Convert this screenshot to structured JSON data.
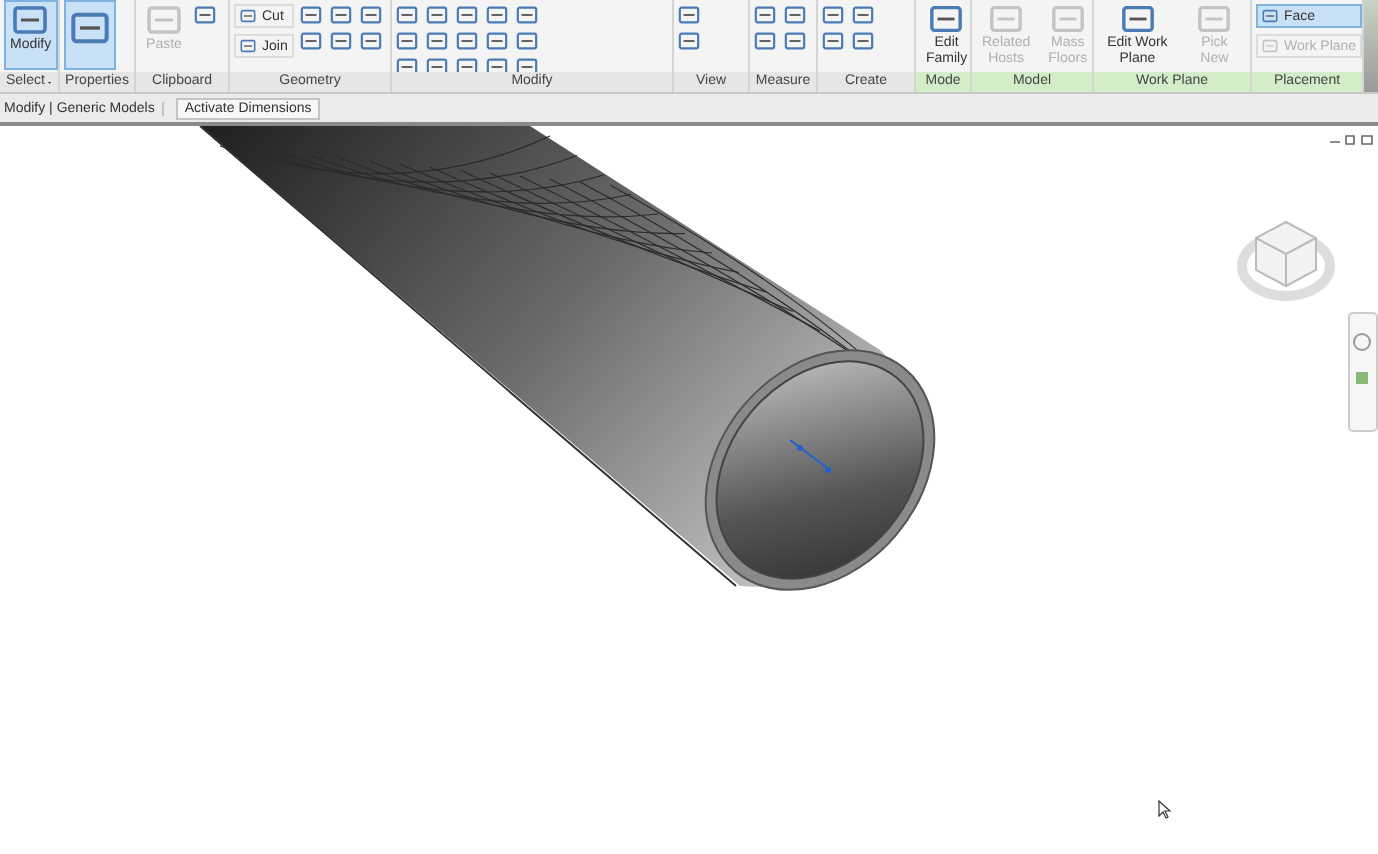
{
  "ribbon": {
    "panels": [
      {
        "label": "Select",
        "dropdown": true,
        "contextual": false,
        "items": [
          {
            "kind": "large",
            "label": "Modify",
            "selected": true,
            "disabled": false
          }
        ]
      },
      {
        "label": "Properties",
        "contextual": false,
        "items": [
          {
            "kind": "large-icon",
            "selected": true,
            "disabled": false
          }
        ]
      },
      {
        "label": "Clipboard",
        "contextual": false,
        "items": [
          {
            "kind": "large",
            "label": "Paste",
            "selected": false,
            "disabled": true
          }
        ]
      },
      {
        "label": "Geometry",
        "contextual": false,
        "items": [
          {
            "kind": "small",
            "label": "Cut",
            "selected": false,
            "disabled": false
          },
          {
            "kind": "small",
            "label": "Join",
            "selected": false,
            "disabled": false
          }
        ]
      },
      {
        "label": "Modify",
        "contextual": false
      },
      {
        "label": "View",
        "contextual": false
      },
      {
        "label": "Measure",
        "contextual": false
      },
      {
        "label": "Create",
        "contextual": false
      },
      {
        "label": "Mode",
        "contextual": true,
        "items": [
          {
            "kind": "large",
            "label": "Edit Family",
            "selected": false,
            "disabled": false
          }
        ]
      },
      {
        "label": "Model",
        "contextual": true,
        "items": [
          {
            "kind": "large",
            "label": "Related Hosts",
            "selected": false,
            "disabled": true
          },
          {
            "kind": "large",
            "label": "Mass Floors",
            "selected": false,
            "disabled": true
          }
        ]
      },
      {
        "label": "Work Plane",
        "contextual": true,
        "items": [
          {
            "kind": "large",
            "label": "Edit Work Plane",
            "selected": false,
            "disabled": false
          },
          {
            "kind": "large",
            "label": "Pick New",
            "selected": false,
            "disabled": true
          }
        ]
      },
      {
        "label": "Placement",
        "contextual": true,
        "items": [
          {
            "kind": "small",
            "label": "Face",
            "selected": true,
            "disabled": false
          },
          {
            "kind": "small",
            "label": "Work Plane",
            "selected": false,
            "disabled": true
          }
        ]
      }
    ]
  },
  "options_bar": {
    "context": "Modify | Generic Models",
    "button": "Activate Dimensions"
  }
}
